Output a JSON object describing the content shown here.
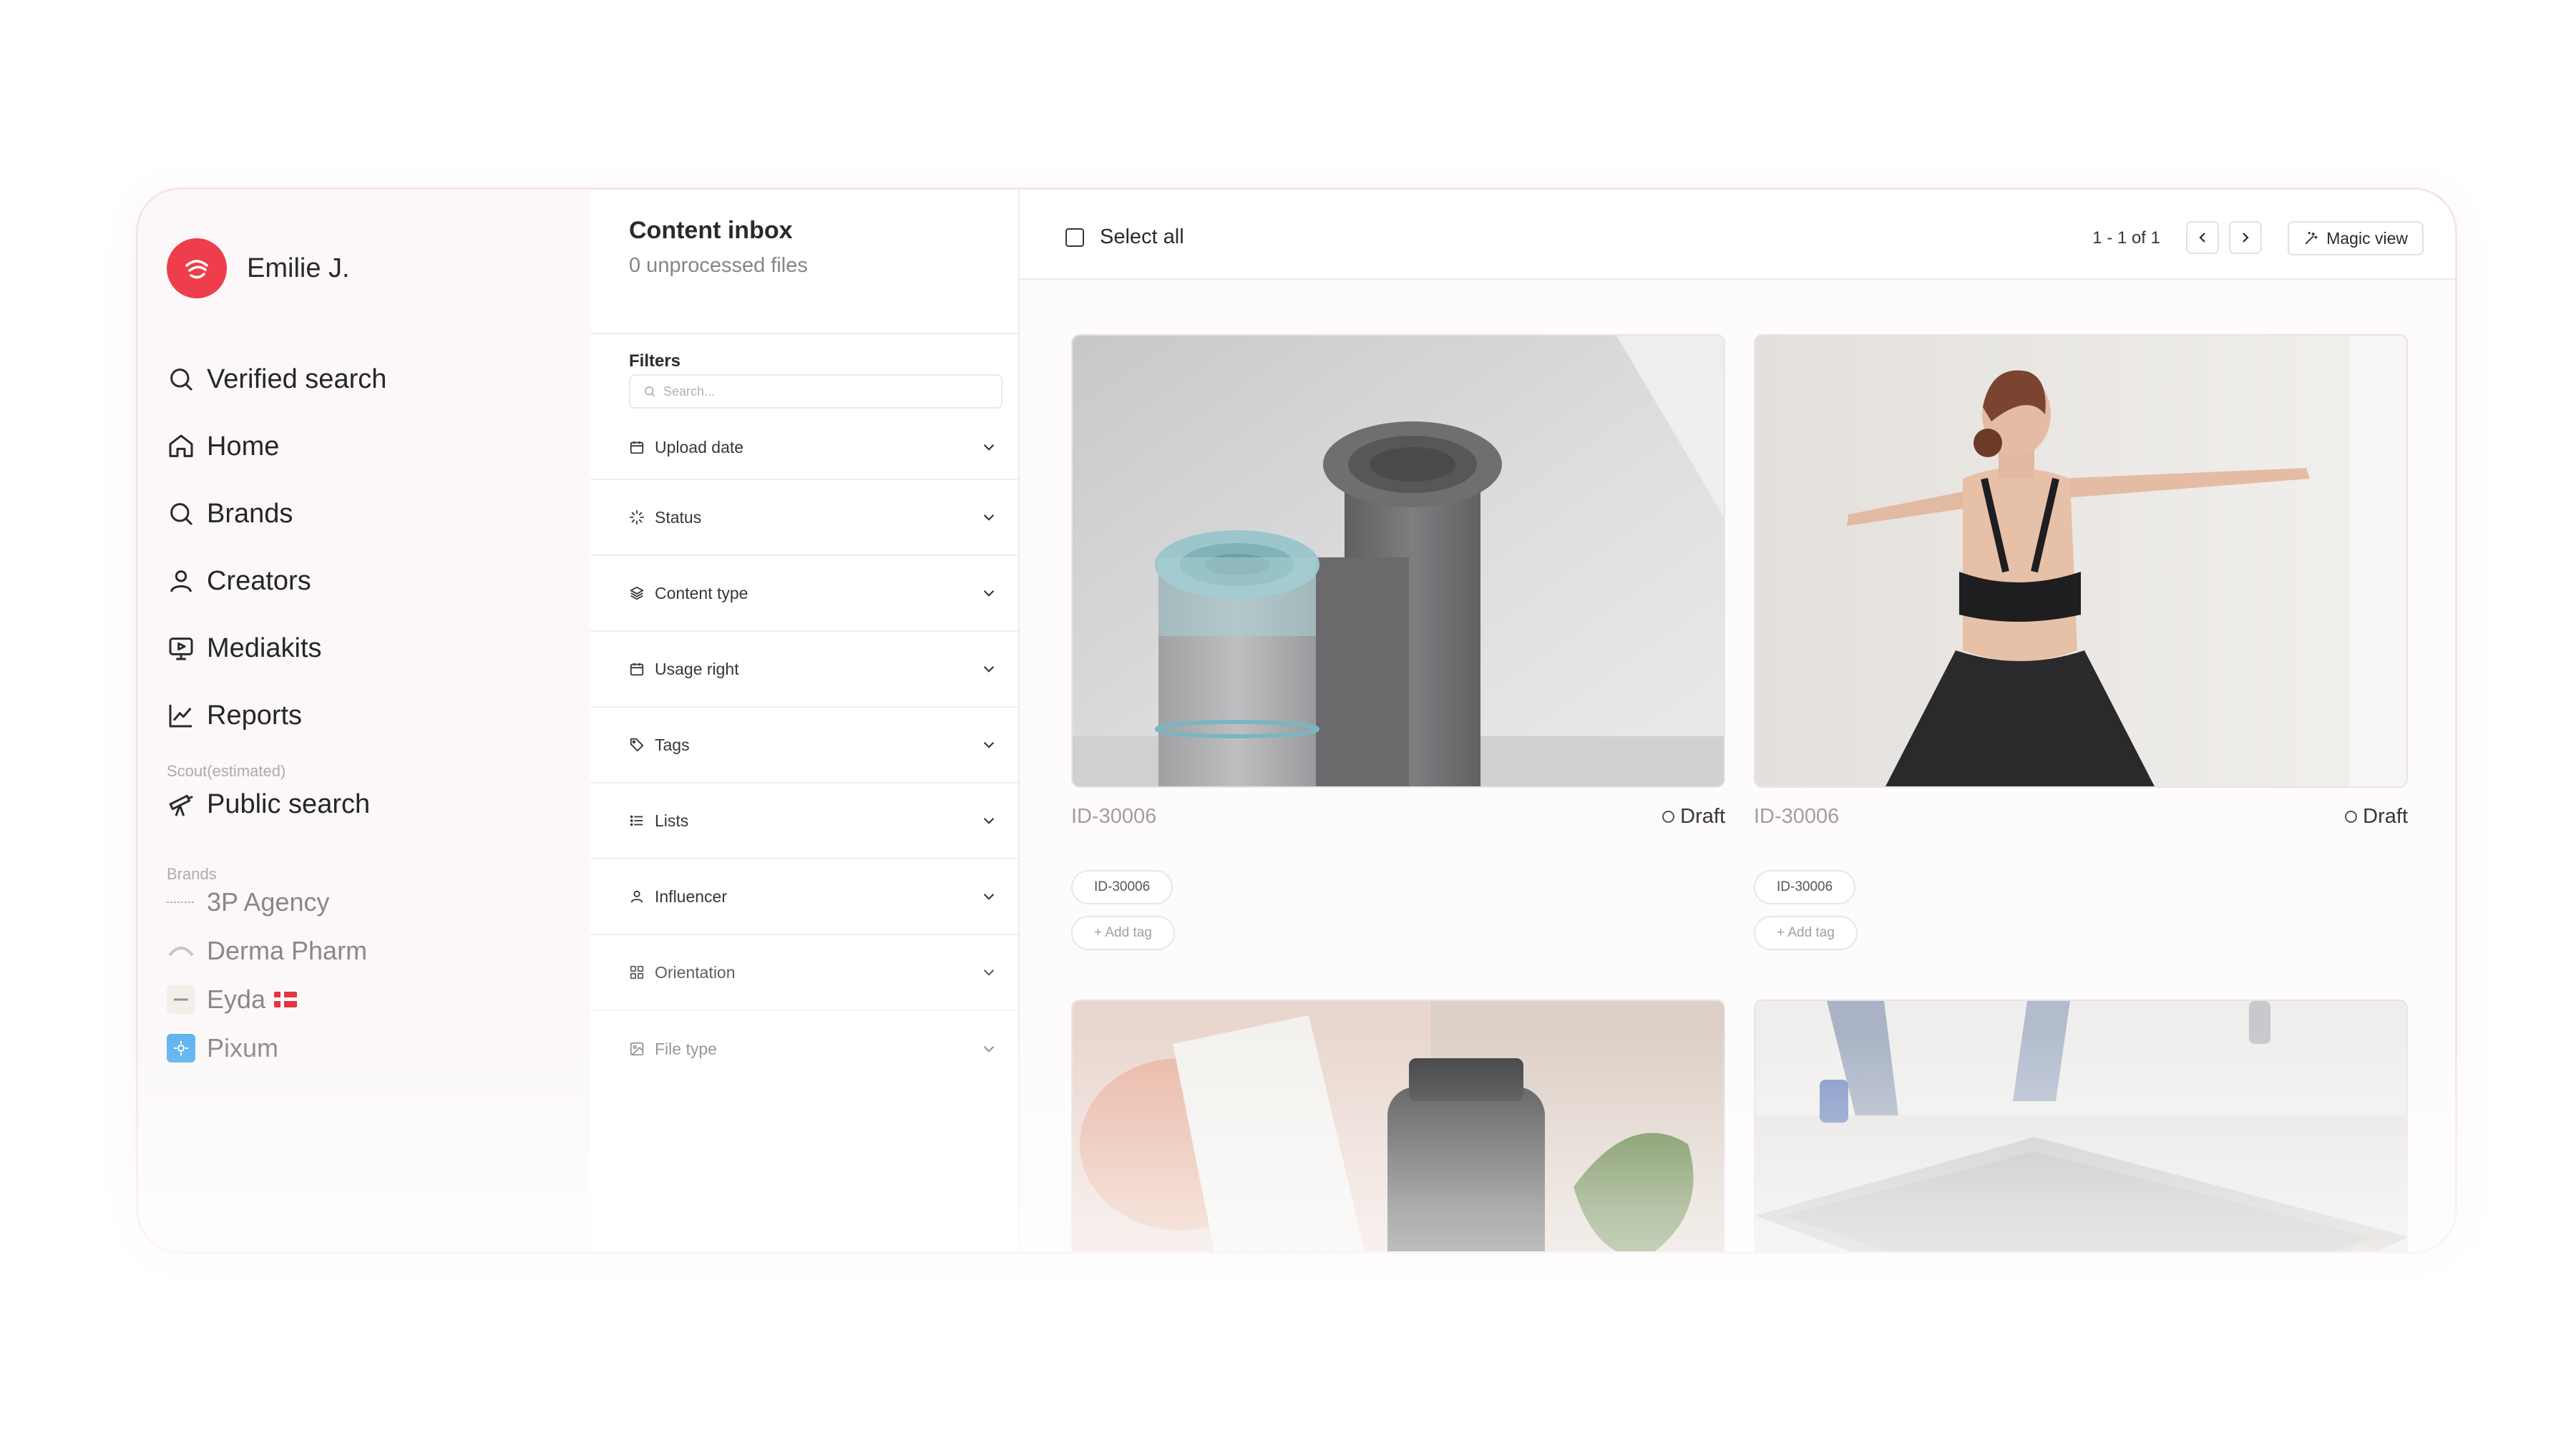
{
  "user": {
    "name": "Emilie J."
  },
  "nav": [
    {
      "label": "Verified search",
      "icon": "search-icon"
    },
    {
      "label": "Home",
      "icon": "home-icon"
    },
    {
      "label": "Brands",
      "icon": "search-icon"
    },
    {
      "label": "Creators",
      "icon": "user-icon"
    },
    {
      "label": "Mediakits",
      "icon": "mediakit-icon"
    },
    {
      "label": "Reports",
      "icon": "chart-icon"
    }
  ],
  "scout": {
    "section_label": "Scout(estimated)",
    "public_search": "Public search"
  },
  "brands": {
    "section_label": "Brands",
    "items": [
      {
        "label": "3P Agency"
      },
      {
        "label": "Derma Pharm"
      },
      {
        "label": "Eyda"
      },
      {
        "label": "Pixum"
      }
    ]
  },
  "inbox": {
    "title": "Content inbox",
    "subtitle": "0 unprocessed files"
  },
  "filters": {
    "label": "Filters",
    "search_placeholder": "Search...",
    "items": [
      {
        "label": "Upload date",
        "icon": "calendar-icon"
      },
      {
        "label": "Status",
        "icon": "loader-icon"
      },
      {
        "label": "Content type",
        "icon": "layers-icon"
      },
      {
        "label": "Usage right",
        "icon": "calendar-icon"
      },
      {
        "label": "Tags",
        "icon": "tag-icon"
      },
      {
        "label": "Lists",
        "icon": "list-icon"
      },
      {
        "label": "Influencer",
        "icon": "user-icon"
      },
      {
        "label": "Orientation",
        "icon": "grid-icon"
      },
      {
        "label": "File type",
        "icon": "image-icon"
      }
    ]
  },
  "toolbar": {
    "select_all": "Select all",
    "pager": "1 - 1 of 1",
    "magic_view": "Magic view"
  },
  "cards": [
    {
      "id": "ID-30006",
      "status": "Draft",
      "tag": "ID-30006",
      "add_tag": "+ Add tag"
    },
    {
      "id": "ID-30006",
      "status": "Draft",
      "tag": "ID-30006",
      "add_tag": "+ Add tag"
    }
  ],
  "colors": {
    "brand": "#ee3e4b",
    "sidebar_bg": "#fcf8fa",
    "frame_border": "#f3e4ec"
  }
}
